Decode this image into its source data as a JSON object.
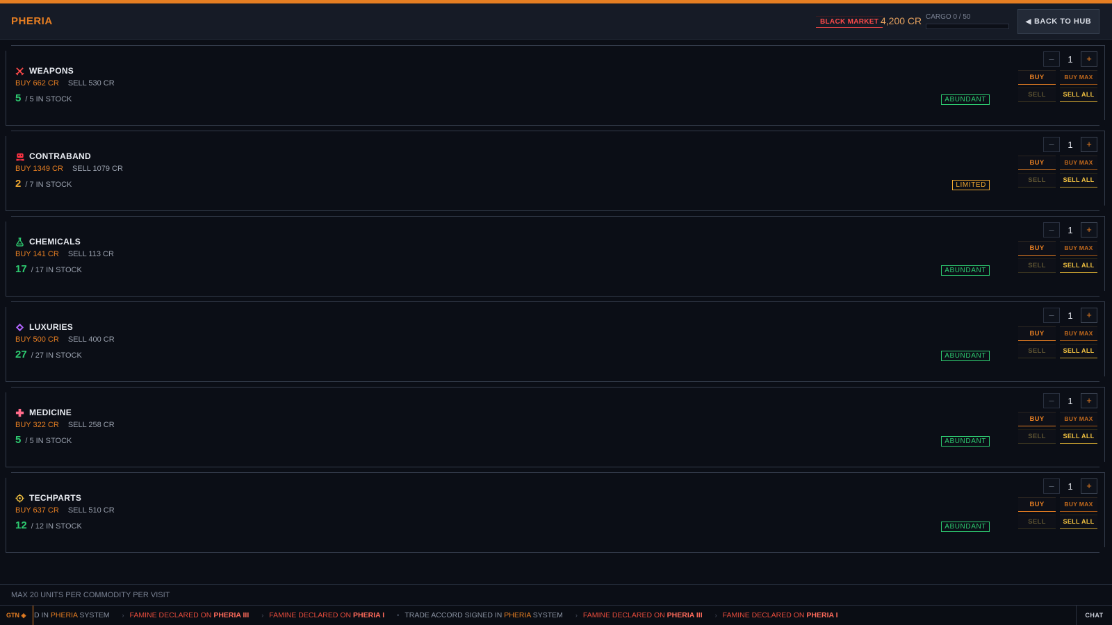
{
  "header": {
    "planet": "PHERIA",
    "market_badge": "BLACK MARKET",
    "credits": "4,200 CR",
    "cargo_label": "CARGO 0 / 50",
    "cargo_fill": 0,
    "back_label": "BACK TO HUB"
  },
  "commodities": [
    {
      "name": "WEAPONS",
      "buy": "BUY 662 CR",
      "sell": "SELL 530 CR",
      "stock": "5",
      "stock_total": "/ 5 IN STOCK",
      "status": "ABUNDANT",
      "qty": "1",
      "icon": "swords-icon",
      "icon_color": "#ff4a4a"
    },
    {
      "name": "CONTRABAND",
      "buy": "BUY 1349 CR",
      "sell": "SELL 1079 CR",
      "stock": "2",
      "stock_total": "/ 7 IN STOCK",
      "status": "LIMITED",
      "qty": "1",
      "icon": "skull-icon",
      "icon_color": "#ff3344"
    },
    {
      "name": "CHEMICALS",
      "buy": "BUY 141 CR",
      "sell": "SELL 113 CR",
      "stock": "17",
      "stock_total": "/ 17 IN STOCK",
      "status": "ABUNDANT",
      "qty": "1",
      "icon": "flask-icon",
      "icon_color": "#2ecc71"
    },
    {
      "name": "LUXURIES",
      "buy": "BUY 500 CR",
      "sell": "SELL 400 CR",
      "stock": "27",
      "stock_total": "/ 27 IN STOCK",
      "status": "ABUNDANT",
      "qty": "1",
      "icon": "gem-icon",
      "icon_color": "#b266ff"
    },
    {
      "name": "MEDICINE",
      "buy": "BUY 322 CR",
      "sell": "SELL 258 CR",
      "stock": "5",
      "stock_total": "/ 5 IN STOCK",
      "status": "ABUNDANT",
      "qty": "1",
      "icon": "cross-icon",
      "icon_color": "#ff6b8a"
    },
    {
      "name": "TECHPARTS",
      "buy": "BUY 637 CR",
      "sell": "SELL 510 CR",
      "stock": "12",
      "stock_total": "/ 12 IN STOCK",
      "status": "ABUNDANT",
      "qty": "1",
      "icon": "gear-icon",
      "icon_color": "#f0c040"
    }
  ],
  "actions": {
    "minus": "–",
    "plus": "+",
    "buy": "BUY",
    "buy_max": "BUY MAX",
    "sell": "SELL",
    "sell_all": "SELL ALL"
  },
  "footer_note": "MAX 20 UNITS PER COMMODITY PER VISIT",
  "ticker": {
    "label": "GTN ◈",
    "items": [
      {
        "prefix": "D IN ",
        "planet": "PHERIA",
        "suffix": " SYSTEM",
        "tone": "grey"
      },
      {
        "prefix": "FAMINE DECLARED ON ",
        "planet": "PHERIA III",
        "suffix": "",
        "tone": "red"
      },
      {
        "prefix": "FAMINE DECLARED ON ",
        "planet": "PHERIA I",
        "suffix": "",
        "tone": "red"
      },
      {
        "prefix": "TRADE ACCORD SIGNED IN ",
        "planet": "PHERIA",
        "suffix": " SYSTEM",
        "tone": "grey"
      },
      {
        "prefix": "FAMINE DECLARED ON ",
        "planet": "PHERIA III",
        "suffix": "",
        "tone": "red"
      },
      {
        "prefix": "FAMINE DECLARED ON ",
        "planet": "PHERIA I",
        "suffix": "",
        "tone": "red"
      }
    ],
    "chat_label": "CHAT"
  }
}
